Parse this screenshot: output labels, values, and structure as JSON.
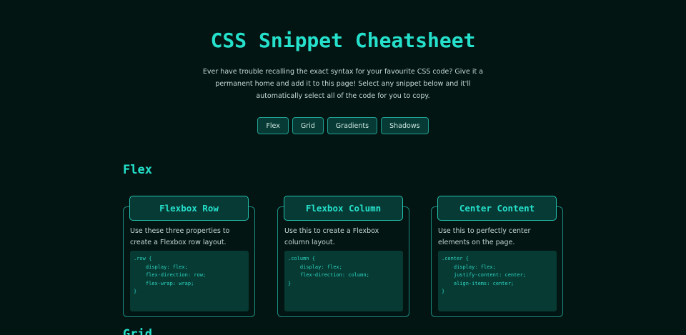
{
  "header": {
    "title": "CSS Snippet Cheatsheet",
    "intro": "Ever have trouble recalling the exact syntax for your favourite CSS code? Give it a permanent home and add it to this page! Select any snippet below and it'll automatically select all of the code for you to copy."
  },
  "nav": {
    "items": [
      {
        "label": "Flex"
      },
      {
        "label": "Grid"
      },
      {
        "label": "Gradients"
      },
      {
        "label": "Shadows"
      }
    ]
  },
  "sections": [
    {
      "title": "Flex",
      "cards": [
        {
          "title": "Flexbox Row",
          "description": "Use these three properties to create a Flexbox row layout.",
          "code": ".row {\n    display: flex;\n    flex-direction: row;\n    flex-wrap: wrap;\n}"
        },
        {
          "title": "Flexbox Column",
          "description": "Use this to create a Flexbox column layout.",
          "code": ".column {\n    display: flex;\n    flex-direction: column;\n}"
        },
        {
          "title": "Center Content",
          "description": "Use this to perfectly center elements on the page.",
          "code": ".center {\n    display: flex;\n    justify-content: center;\n    align-items: center;\n}"
        }
      ]
    },
    {
      "title": "Grid"
    }
  ],
  "colors": {
    "background": "#031513",
    "accent": "#25e0cb",
    "card_header_bg": "#073a34",
    "code_bg": "#063a33"
  }
}
